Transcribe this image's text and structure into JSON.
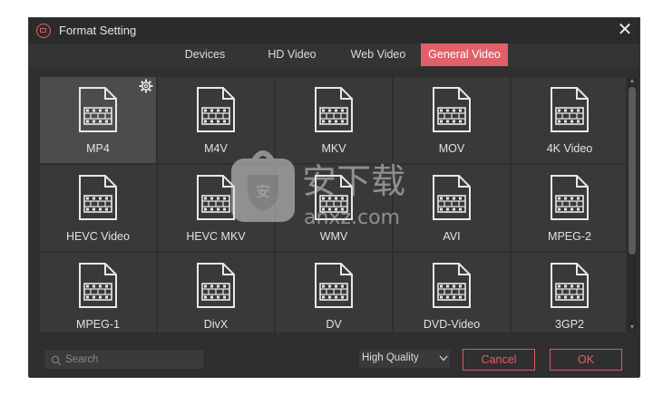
{
  "window": {
    "title": "Format Setting",
    "close_glyph": "✕"
  },
  "tabs": [
    {
      "label": "Devices",
      "active": false
    },
    {
      "label": "HD Video",
      "active": false
    },
    {
      "label": "Web Video",
      "active": false
    },
    {
      "label": "General Video",
      "active": true
    }
  ],
  "formats": [
    {
      "label": "MP4",
      "selected": true
    },
    {
      "label": "M4V"
    },
    {
      "label": "MKV"
    },
    {
      "label": "MOV"
    },
    {
      "label": "4K Video"
    },
    {
      "label": "HEVC Video"
    },
    {
      "label": "HEVC MKV"
    },
    {
      "label": "WMV"
    },
    {
      "label": "AVI"
    },
    {
      "label": "MPEG-2"
    },
    {
      "label": "MPEG-1"
    },
    {
      "label": "DivX"
    },
    {
      "label": "DV"
    },
    {
      "label": "DVD-Video"
    },
    {
      "label": "3GP2"
    }
  ],
  "bottom": {
    "search_placeholder": "Search",
    "quality_value": "High Quality",
    "cancel_label": "Cancel",
    "ok_label": "OK"
  },
  "colors": {
    "accent": "#e1606a",
    "background": "#2f2f2f",
    "tile": "#393939",
    "tile_selected": "#4c4c4c"
  },
  "watermark": {
    "text_cn": "安下载",
    "text_url": "anxz.com"
  }
}
